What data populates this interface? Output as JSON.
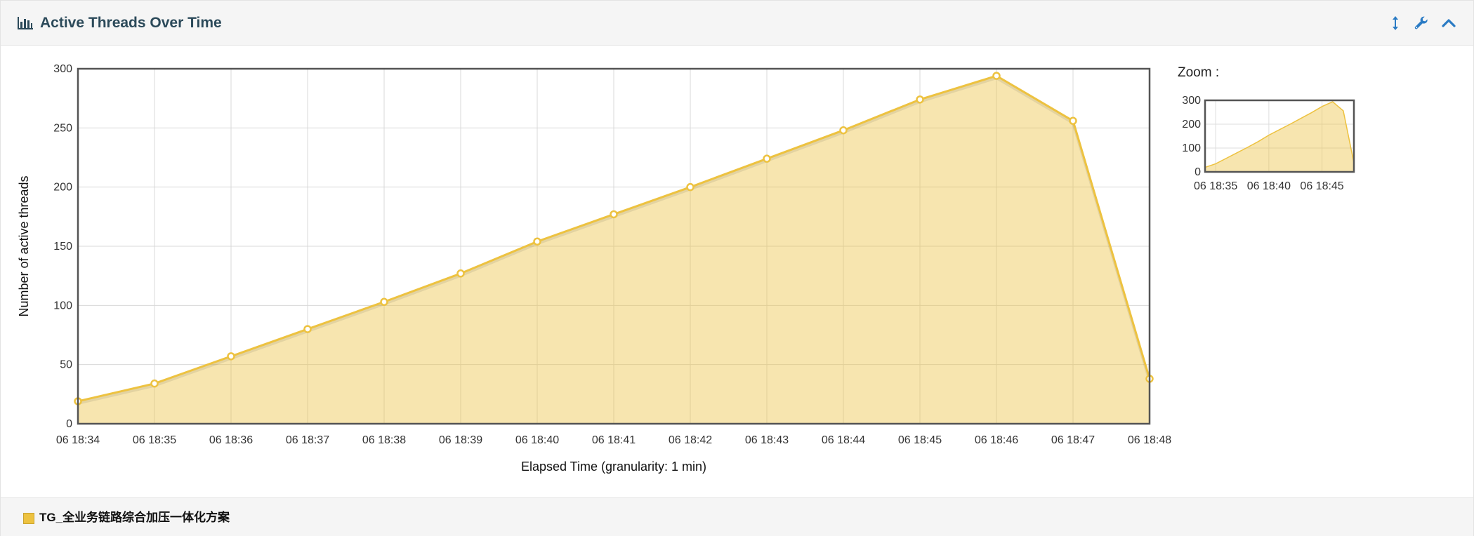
{
  "panel": {
    "title": "Active Threads Over Time",
    "icons": [
      "bar-chart-icon",
      "resize-vertical-icon",
      "wrench-icon",
      "chevron-up-icon"
    ]
  },
  "chart_data": [
    {
      "type": "area",
      "title": "",
      "xlabel": "Elapsed Time (granularity: 1 min)",
      "ylabel": "Number of active threads",
      "x": [
        "06 18:34",
        "06 18:35",
        "06 18:36",
        "06 18:37",
        "06 18:38",
        "06 18:39",
        "06 18:40",
        "06 18:41",
        "06 18:42",
        "06 18:43",
        "06 18:44",
        "06 18:45",
        "06 18:46",
        "06 18:47",
        "06 18:48"
      ],
      "ylim": [
        0,
        300
      ],
      "yticks": [
        0,
        50,
        100,
        150,
        200,
        250,
        300
      ],
      "grid": true,
      "legend_position": "bottom",
      "series": [
        {
          "name": "TG_全业务链路综合加压一体化方案",
          "color": "#edc240",
          "values": [
            19,
            34,
            57,
            80,
            103,
            127,
            154,
            177,
            200,
            224,
            248,
            274,
            294,
            256,
            38
          ]
        }
      ]
    },
    {
      "type": "area",
      "title": "Zoom :",
      "x_ticks": [
        "06 18:35",
        "06 18:40",
        "06 18:45"
      ],
      "ylim": [
        0,
        300
      ],
      "yticks": [
        0,
        100,
        200,
        300
      ],
      "grid": true
    }
  ]
}
